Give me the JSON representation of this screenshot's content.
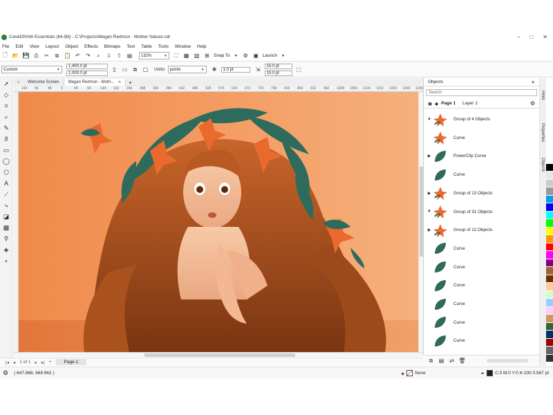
{
  "app": {
    "title": "CorelDRAW Essentials (64-Bit) - C:\\Projects\\Megan Redmon - Mother Nature.cdr"
  },
  "window_buttons": [
    "–",
    "□",
    "✕"
  ],
  "menu": [
    "File",
    "Edit",
    "View",
    "Layout",
    "Object",
    "Effects",
    "Bitmaps",
    "Text",
    "Table",
    "Tools",
    "Window",
    "Help"
  ],
  "toolbar": {
    "zoom": "132%",
    "snap_to": "Snap To",
    "launch": "Launch"
  },
  "propbar": {
    "preset": "Custom",
    "width": "1,400.0 pt",
    "height": "1,000.0 pt",
    "units_label": "Units:",
    "units": "points",
    "nudge": "1.0 pt",
    "dup_x": "15.0 pt",
    "dup_y": "15.0 pt"
  },
  "tabs": {
    "welcome": "Welcome Screen",
    "document": "Megan Redmon - Moth..."
  },
  "ruler_ticks": [
    "144",
    "96",
    "48",
    "0",
    "48",
    "96",
    "144",
    "192",
    "240",
    "288",
    "336",
    "384",
    "432",
    "480",
    "528",
    "576",
    "624",
    "672",
    "720",
    "768",
    "816",
    "864",
    "912",
    "960",
    "1008",
    "1056",
    "1104",
    "1152",
    "1200",
    "1248",
    "1296"
  ],
  "pagenav": {
    "count": "1 of 1",
    "page_tab": "Page 1"
  },
  "docker": {
    "title": "Objects",
    "search_placeholder": "Search",
    "page": "Page 1",
    "layer": "Layer 1",
    "objects": [
      {
        "label": "Group of 4 Objects",
        "arrow": "▼",
        "thumb": "flower"
      },
      {
        "label": "Curve",
        "arrow": "",
        "thumb": "flower"
      },
      {
        "label": "PowerClip Curve",
        "arrow": "▶",
        "thumb": "leaf"
      },
      {
        "label": "Curve",
        "arrow": "",
        "thumb": "leaf"
      },
      {
        "label": "Group of 13 Objects",
        "arrow": "▶",
        "thumb": "flower"
      },
      {
        "label": "Group of 31 Objects",
        "arrow": "▼",
        "thumb": "flower"
      },
      {
        "label": "Group of 12 Objects",
        "arrow": "▶",
        "thumb": "flower"
      },
      {
        "label": "Curve",
        "arrow": "",
        "thumb": "leaf"
      },
      {
        "label": "Curve",
        "arrow": "",
        "thumb": "leaf"
      },
      {
        "label": "Curve",
        "arrow": "",
        "thumb": "leaf"
      },
      {
        "label": "Curve",
        "arrow": "",
        "thumb": "leaf"
      },
      {
        "label": "Curve",
        "arrow": "",
        "thumb": "leaf"
      },
      {
        "label": "Curve",
        "arrow": "",
        "thumb": "leaf"
      }
    ]
  },
  "sidetabs": [
    "Hints",
    "Properties",
    "Objects"
  ],
  "palette": [
    "#ffffff",
    "#000000",
    "#e6e6e6",
    "#cccccc",
    "#999999",
    "#00a0e9",
    "#0000ff",
    "#00ffff",
    "#00ff00",
    "#ffff00",
    "#ff9900",
    "#ff0000",
    "#ff00ff",
    "#800080",
    "#996633",
    "#663300",
    "#ffcc99",
    "#ccffcc",
    "#99ccff",
    "#ffccff",
    "#cc9966",
    "#336633",
    "#003366",
    "#990000",
    "#666666",
    "#333333"
  ],
  "status": {
    "coords": "( 647.868, 669.962 )",
    "fill_label": "None",
    "outline": "C:0 M:0 Y:0 K:100  0.567 pt"
  },
  "colors": {
    "canvas_a": "#f08a4b",
    "canvas_b": "#f6b07c",
    "hair": "#b35a1e",
    "leaf": "#2f6b5c",
    "lily": "#ea6a2e"
  }
}
